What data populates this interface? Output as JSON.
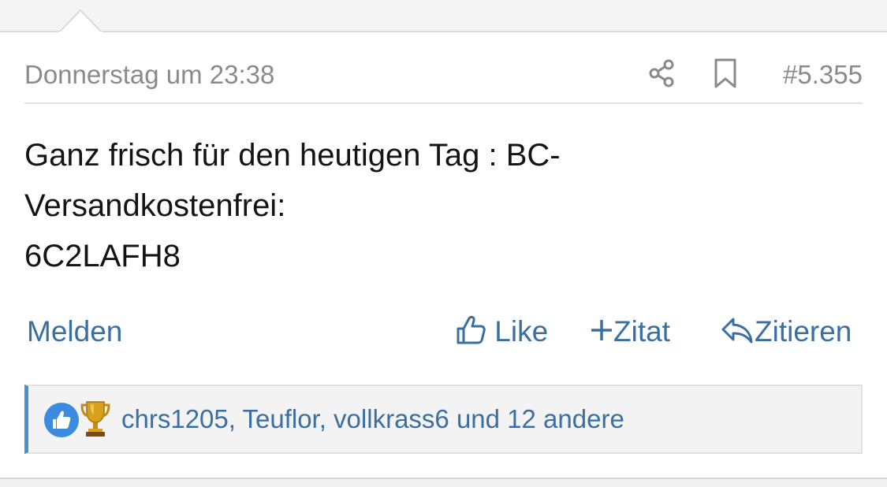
{
  "post": {
    "date": "Donnerstag um 23:38",
    "number": "#5.355",
    "body": {
      "line1": "Ganz frisch für den heutigen Tag : BC-",
      "line2": "Versandkostenfrei:",
      "line3": "6C2LAFH8"
    }
  },
  "icons": {
    "share": "share-icon",
    "bookmark": "bookmark-icon",
    "like": "thumbs-up-icon",
    "quote": "plus-icon",
    "reply": "reply-icon",
    "reaction_like": "like-reaction-icon",
    "reaction_trophy": "trophy-reaction-icon"
  },
  "actions": {
    "report": "Melden",
    "like": "Like",
    "quote": "Zitat",
    "reply": "Zitieren"
  },
  "reactions": {
    "users": "chrs1205, Teuflor, vollkrass6 und 12 andere"
  },
  "colors": {
    "link": "#3b6fa1",
    "meta": "#8a8a8a",
    "reaction_accent": "#4a8fd4",
    "trophy": "#d9a01e"
  }
}
